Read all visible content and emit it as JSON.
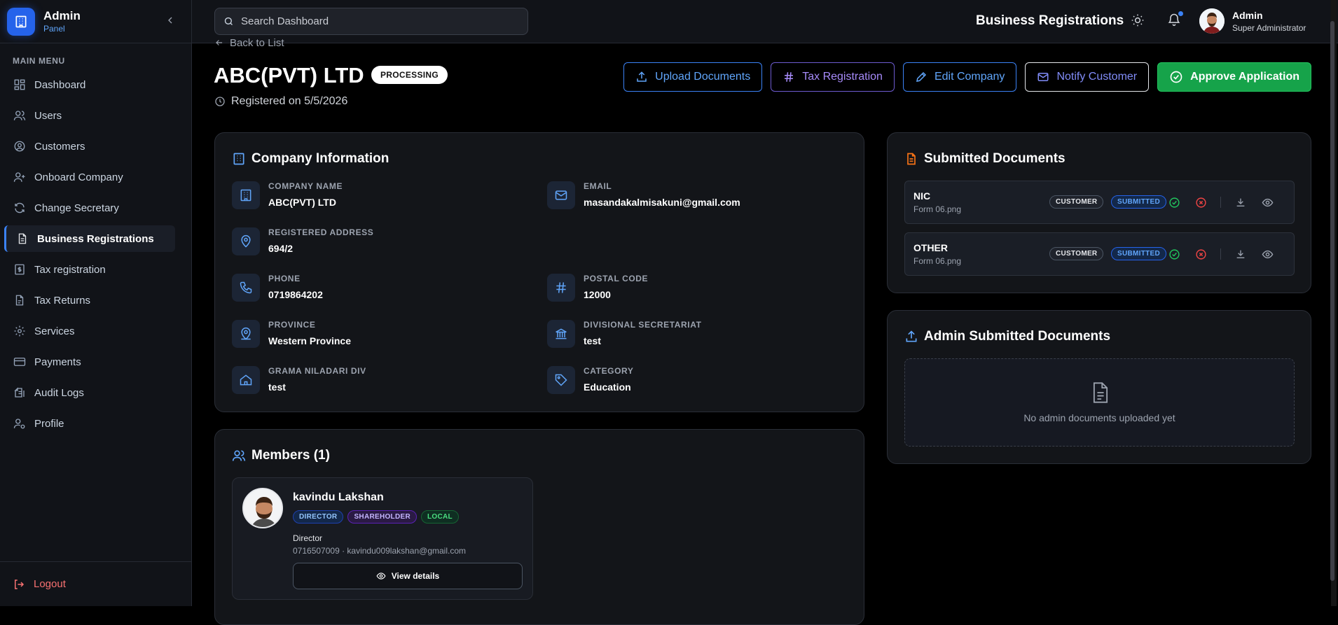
{
  "brand": {
    "title": "Admin",
    "subtitle": "Panel"
  },
  "sidebar": {
    "section_label": "MAIN MENU",
    "items": [
      {
        "label": "Dashboard",
        "icon": "dashboard-icon"
      },
      {
        "label": "Users",
        "icon": "users-icon"
      },
      {
        "label": "Customers",
        "icon": "customers-icon"
      },
      {
        "label": "Onboard Company",
        "icon": "user-plus-icon"
      },
      {
        "label": "Change Secretary",
        "icon": "refresh-icon"
      },
      {
        "label": "Business Registrations",
        "icon": "document-icon",
        "active": true
      },
      {
        "label": "Tax registration",
        "icon": "receipt-icon"
      },
      {
        "label": "Tax Returns",
        "icon": "file-icon"
      },
      {
        "label": "Services",
        "icon": "gear-icon"
      },
      {
        "label": "Payments",
        "icon": "credit-card-icon"
      },
      {
        "label": "Audit Logs",
        "icon": "clipboard-icon"
      },
      {
        "label": "Profile",
        "icon": "user-gear-icon"
      }
    ],
    "logout_label": "Logout"
  },
  "topbar": {
    "search_placeholder": "Search Dashboard",
    "title": "Business Registrations",
    "user": {
      "name": "Admin",
      "role": "Super Administrator"
    }
  },
  "page": {
    "back_label": "Back to List",
    "company_title": "ABC(PVT) LTD",
    "status": "PROCESSING",
    "registered": "Registered on 5/5/2026"
  },
  "actions": {
    "upload": "Upload Documents",
    "tax": "Tax Registration",
    "edit": "Edit Company",
    "notify": "Notify Customer",
    "approve": "Approve Application"
  },
  "company_info": {
    "title": "Company Information",
    "fields": {
      "company_name": {
        "label": "COMPANY NAME",
        "value": "ABC(PVT) LTD"
      },
      "email": {
        "label": "EMAIL",
        "value": "masandakalmisakuni@gmail.com"
      },
      "address": {
        "label": "REGISTERED ADDRESS",
        "value": "694/2"
      },
      "phone": {
        "label": "PHONE",
        "value": "0719864202"
      },
      "postal": {
        "label": "POSTAL CODE",
        "value": "12000"
      },
      "province": {
        "label": "PROVINCE",
        "value": "Western Province"
      },
      "divisional": {
        "label": "DIVISIONAL SECRETARIAT",
        "value": "test"
      },
      "grama": {
        "label": "GRAMA NILADARI DIV",
        "value": "test"
      },
      "category": {
        "label": "CATEGORY",
        "value": "Education"
      }
    }
  },
  "submitted_documents": {
    "title": "Submitted Documents",
    "items": [
      {
        "name": "NIC",
        "file": "Form 06.png",
        "source": "CUSTOMER",
        "status": "SUBMITTED"
      },
      {
        "name": "OTHER",
        "file": "Form 06.png",
        "source": "CUSTOMER",
        "status": "SUBMITTED"
      }
    ]
  },
  "admin_documents": {
    "title": "Admin Submitted Documents",
    "empty_text": "No admin documents uploaded yet"
  },
  "members": {
    "title": "Members (1)",
    "items": [
      {
        "name": "kavindu Lakshan",
        "tags": [
          "DIRECTOR",
          "SHAREHOLDER",
          "LOCAL"
        ],
        "role": "Director",
        "contact": "0716507009 · kavindu009lakshan@gmail.com",
        "view_label": "View details"
      }
    ]
  },
  "colors": {
    "accent": "#3b82f6",
    "approve": "#16a34a",
    "danger": "#ef4444",
    "success": "#22c55e",
    "background": "#000000",
    "card": "#131519"
  }
}
